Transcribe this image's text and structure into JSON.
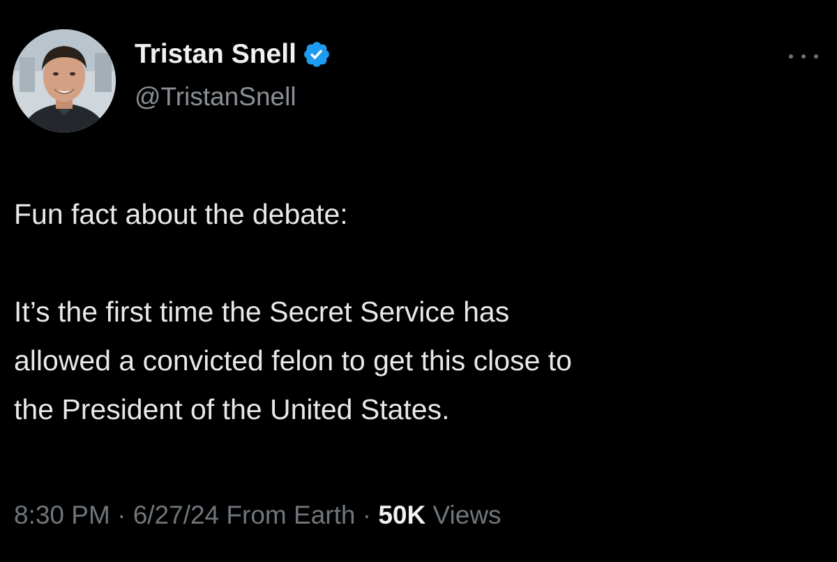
{
  "author": {
    "display_name": "Tristan Snell",
    "handle": "@TristanSnell",
    "verified_icon": "verified-badge-icon",
    "verified_color": "#1d9bf0"
  },
  "menu": {
    "icon": "more-options-icon"
  },
  "tweet": {
    "lines": [
      "Fun fact about the debate:",
      "It’s the first time the Secret Service has",
      "allowed a convicted felon to get this close to",
      "the President of the United States."
    ]
  },
  "meta": {
    "time": "8:30 PM",
    "separator": "·",
    "date": "6/27/24",
    "source": "From Earth",
    "views_count": "50K",
    "views_label": "Views"
  },
  "colors": {
    "background": "#000000",
    "text": "#e7e9ea",
    "secondary_text": "#70767b",
    "accent": "#1d9bf0"
  }
}
